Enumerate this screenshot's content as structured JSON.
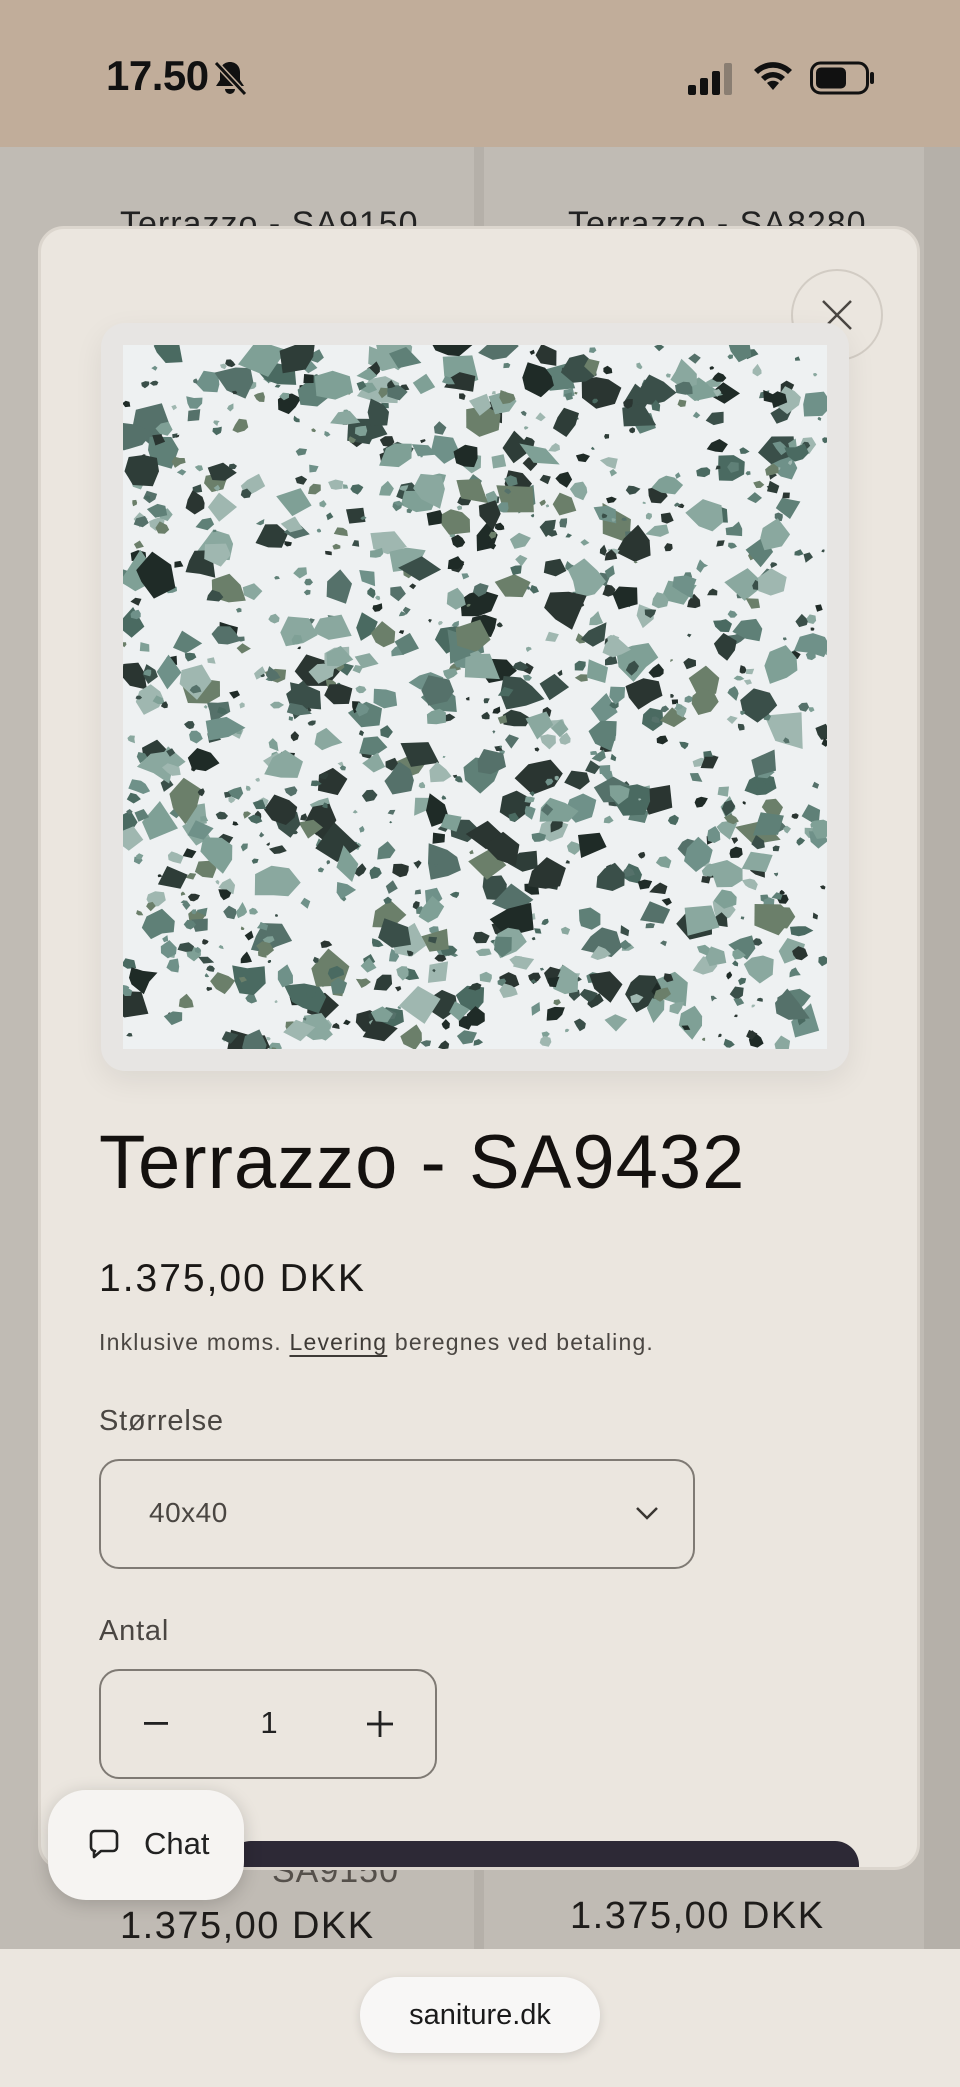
{
  "status_bar": {
    "time": "17.50",
    "icons": [
      "bell-slash-icon",
      "signal-icon",
      "wifi-icon",
      "battery-icon"
    ]
  },
  "background_products": [
    {
      "title": "Terrazzo - SA9150",
      "price": "1.375,00 DKK",
      "bottom_title_fragment": "SA9150"
    },
    {
      "title": "Terrazzo - SA8280",
      "price": "1.375,00 DKK"
    }
  ],
  "modal": {
    "close_icon": "close-icon",
    "product": {
      "title": "Terrazzo - SA9432",
      "price": "1.375,00 DKK",
      "tax_prefix": "Inklusive moms.",
      "shipping_link": "Levering",
      "tax_suffix": "beregnes ved betaling."
    },
    "size": {
      "label": "Størrelse",
      "selected": "40x40"
    },
    "quantity": {
      "label": "Antal",
      "value": "1",
      "decrement": "−",
      "increment": "+"
    }
  },
  "chat": {
    "label": "Chat"
  },
  "browser": {
    "url": "saniture.dk"
  },
  "colors": {
    "status_bar": "#c1ad9a",
    "modal_bg": "#ebe6df",
    "cart_button": "#2d2936"
  }
}
